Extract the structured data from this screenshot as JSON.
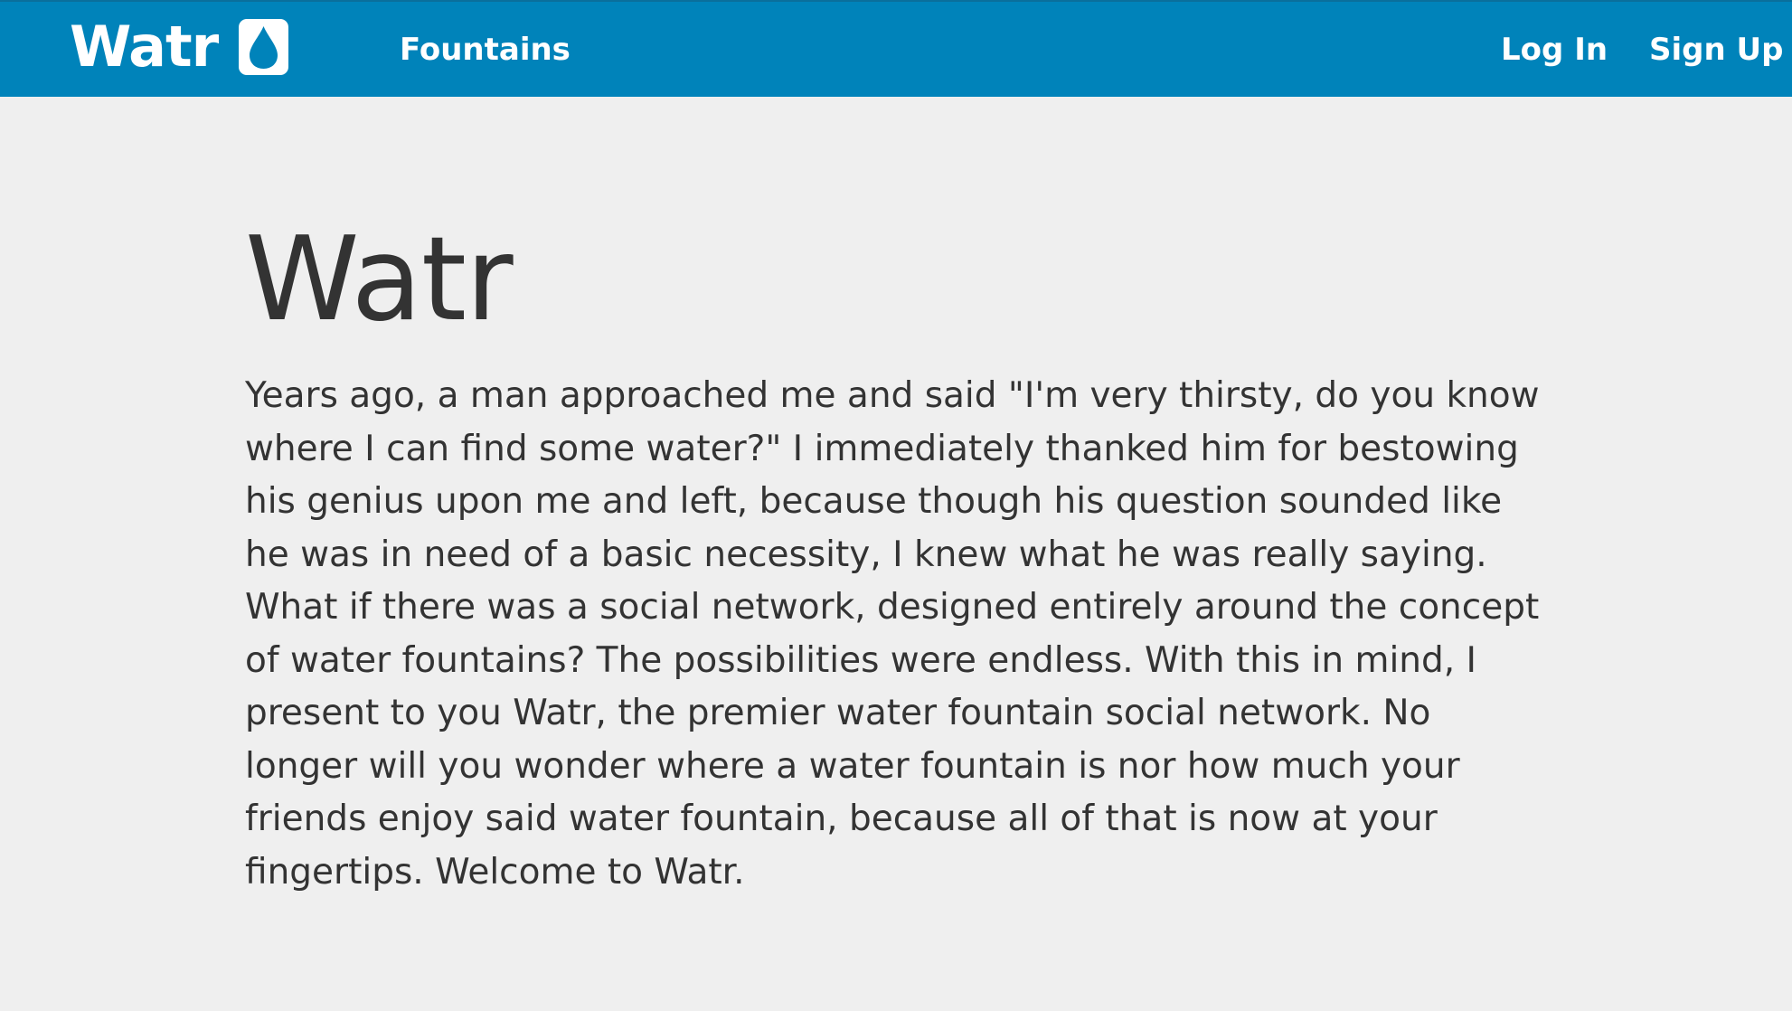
{
  "navbar": {
    "brand": "Watr",
    "brand_icon": "water-drop-icon",
    "links": {
      "fountains": "Fountains",
      "login": "Log In",
      "signup": "Sign Up"
    },
    "background_color": "#0083ba"
  },
  "main": {
    "title": "Watr",
    "description": "Years ago, a man approached me and said \"I'm very thirsty, do you know where I can find some water?\" I immediately thanked him for bestowing his genius upon me and left, because though his question sounded like he was in need of a basic necessity, I knew what he was really saying. What if there was a social network, designed entirely around the concept of water fountains? The possibilities were endless. With this in mind, I present to you Watr, the premier water fountain social network. No longer will you wonder where a water fountain is nor how much your friends enjoy said water fountain, because all of that is now at your fingertips. Welcome to Watr."
  }
}
